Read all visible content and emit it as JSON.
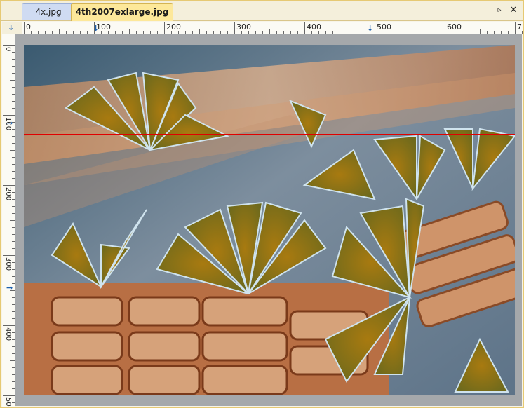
{
  "tabs": [
    {
      "label": "4x.jpg",
      "active": false
    },
    {
      "label": "4th2007exlarge.jpg",
      "active": true
    }
  ],
  "buttons": {
    "scroll_right": "▹",
    "close": "✕"
  },
  "ruler": {
    "h_labels": [
      "0",
      "100",
      "200",
      "300",
      "400",
      "500",
      "600",
      "7"
    ],
    "v_labels": [
      "0",
      "100",
      "200",
      "300",
      "400",
      "50"
    ]
  },
  "guides": {
    "vertical": [
      100,
      492
    ],
    "horizontal": [
      128,
      350
    ]
  },
  "colors": {
    "guide": "#e00000",
    "active_tab": "#fde89a",
    "inactive_tab": "#cfdbf2",
    "canvas_bg": "#a5a8ab",
    "marker": "#1b5fae"
  },
  "image": {
    "description_icon": "diatom-micrograph-image"
  }
}
